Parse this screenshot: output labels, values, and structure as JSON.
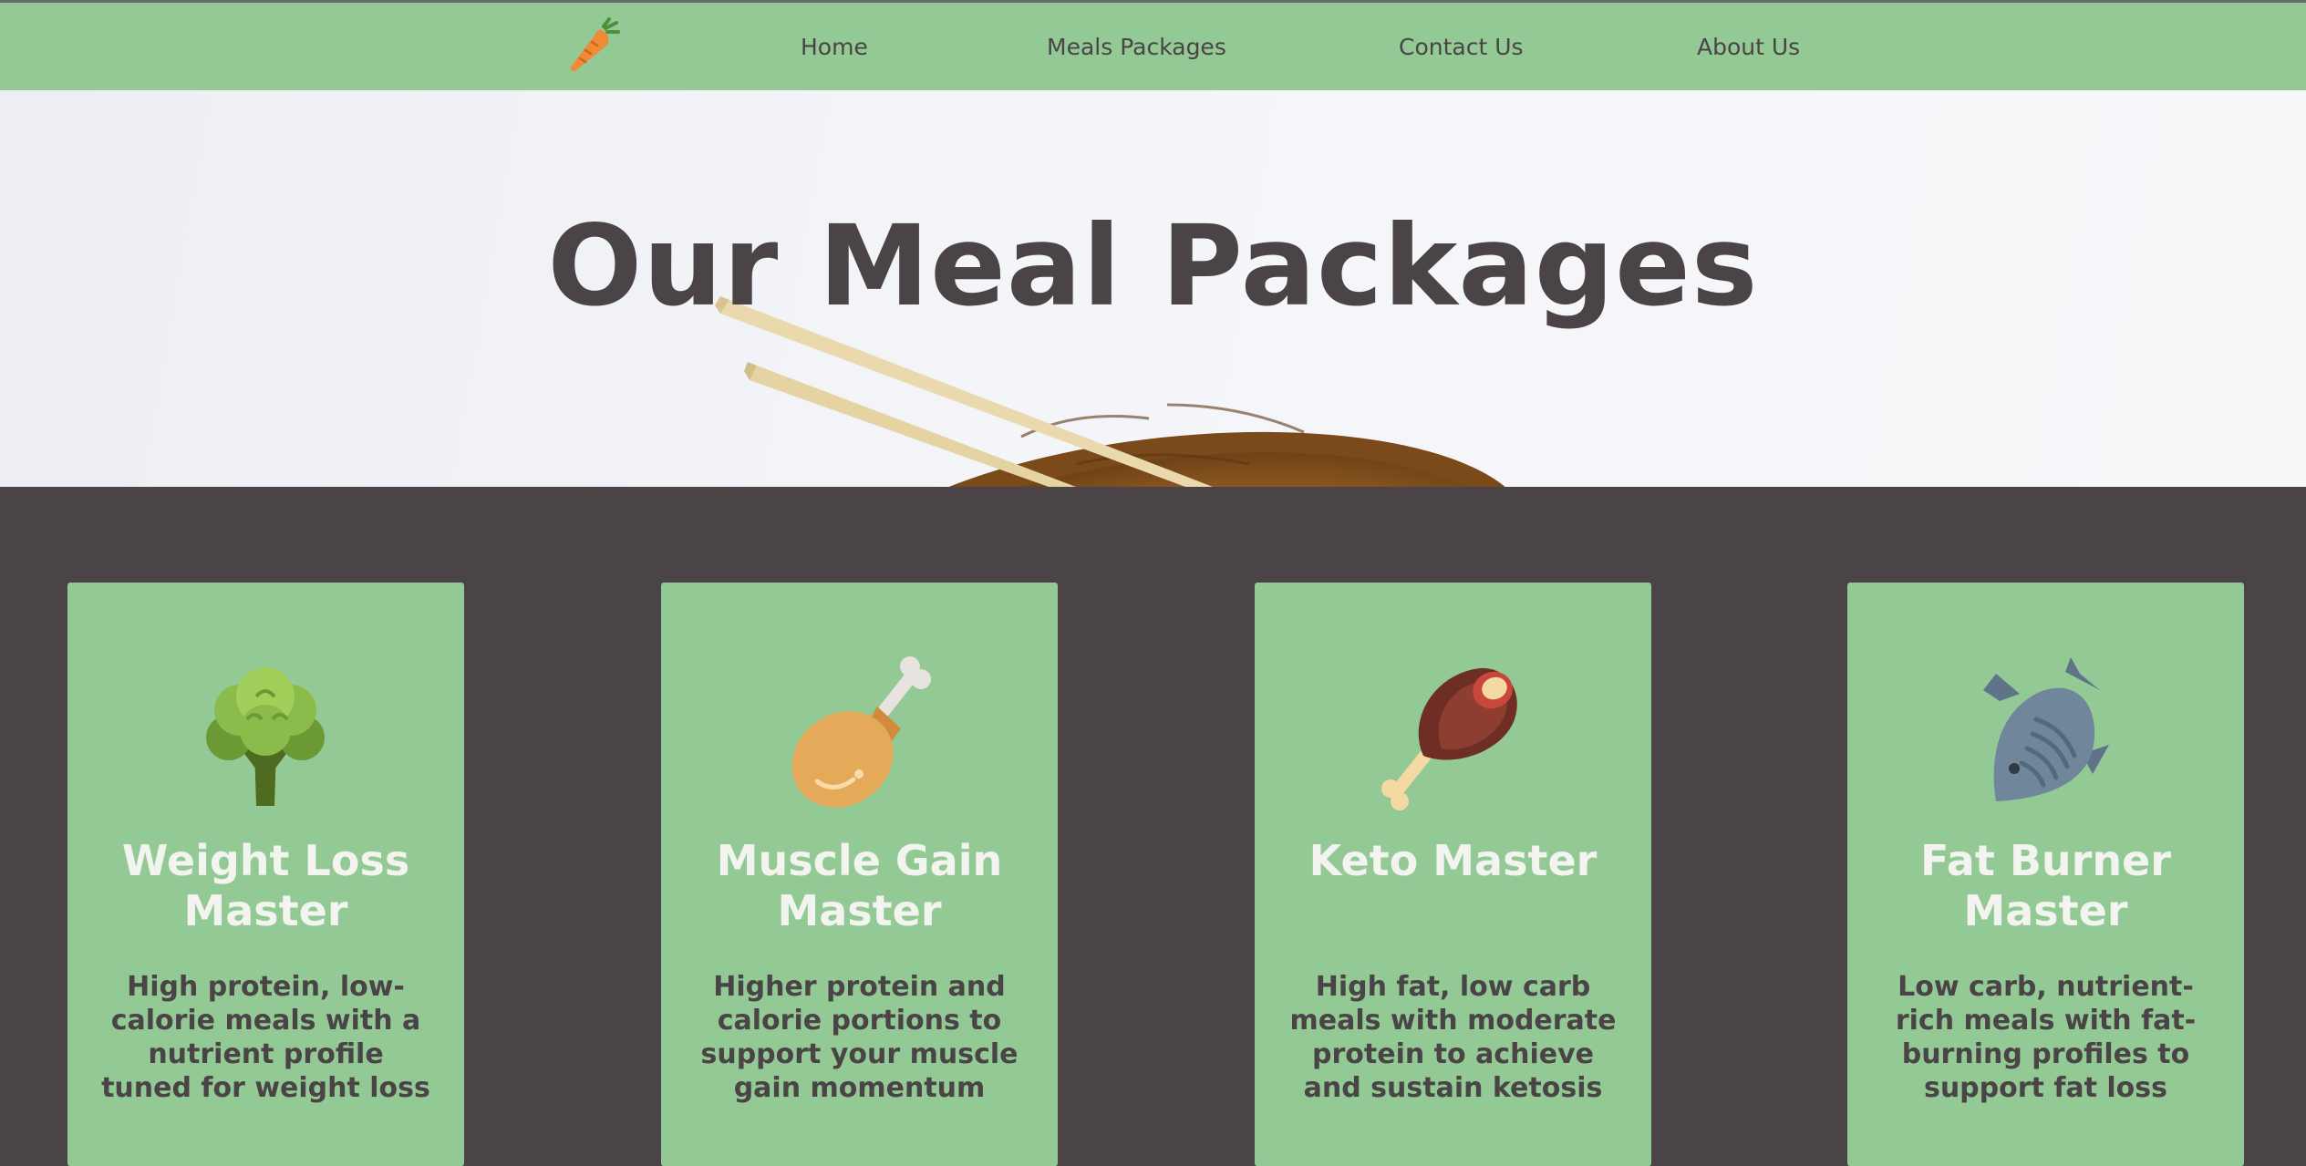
{
  "nav": {
    "logo_icon": "carrot-icon",
    "links": [
      "Home",
      "Meals Packages",
      "Contact Us",
      "About Us"
    ]
  },
  "hero": {
    "title": "Our Meal Packages"
  },
  "packages": [
    {
      "title": "Weight Loss Master",
      "icon": "broccoli-icon",
      "description": "High protein, low-calorie meals with a nutrient profile tuned for weight loss"
    },
    {
      "title": "Muscle Gain Master",
      "icon": "chicken-leg-icon",
      "description": "Higher protein and calorie portions to support your muscle gain momentum"
    },
    {
      "title": "Keto Master",
      "icon": "ham-icon",
      "description": "High fat, low carb meals with moderate protein to achieve and sustain ketosis"
    },
    {
      "title": "Fat Burner Master",
      "icon": "fish-icon",
      "description": "Low carb, nutrient-rich meals with fat-burning profiles to support fat loss"
    }
  ],
  "colors": {
    "nav_bg": "#93c994",
    "card_bg": "#93c994",
    "page_bg": "#4a4446",
    "title_text": "#4a4446",
    "card_title_text": "#f3f3f0"
  }
}
